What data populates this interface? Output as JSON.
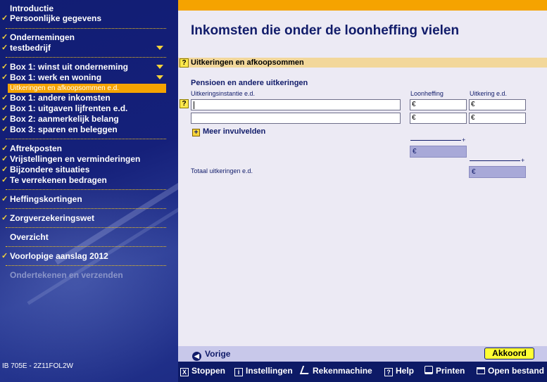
{
  "sidebar": {
    "items": [
      {
        "label": "Introductie",
        "checked": false
      },
      {
        "label": "Persoonlijke gegevens",
        "checked": true
      },
      {
        "label": "Ondernemingen",
        "checked": true
      },
      {
        "label": "testbedrijf",
        "checked": true
      },
      {
        "label": "Box 1: winst uit onderneming",
        "checked": true
      },
      {
        "label": "Box 1: werk en woning",
        "checked": true
      },
      {
        "label": "Uitkeringen en afkoopsommen e.d.",
        "active": true
      },
      {
        "label": "Box 1: andere inkomsten",
        "checked": true
      },
      {
        "label": "Box 1: uitgaven lijfrenten e.d.",
        "checked": true
      },
      {
        "label": "Box 2: aanmerkelijk belang",
        "checked": true
      },
      {
        "label": "Box 3: sparen en beleggen",
        "checked": true
      },
      {
        "label": "Aftrekposten",
        "checked": true
      },
      {
        "label": "Vrijstellingen en verminderingen",
        "checked": true
      },
      {
        "label": "Bijzondere situaties",
        "checked": true
      },
      {
        "label": "Te verrekenen bedragen",
        "checked": true
      },
      {
        "label": "Heffingskortingen",
        "checked": true
      },
      {
        "label": "Zorgverzekeringswet",
        "checked": true
      },
      {
        "label": "Overzicht",
        "checked": false
      },
      {
        "label": "Voorlopige aanslag 2012",
        "checked": true
      },
      {
        "label": "Ondertekenen en verzenden",
        "disabled": true
      }
    ],
    "footer_code": "IB 705E - 2Z11FOL2W",
    "check_glyph": "✓"
  },
  "main": {
    "title": "Inkomsten die onder de loonheffing vielen",
    "help_glyph": "?",
    "section_title": "Uitkeringen en afkoopsommen",
    "group_title": "Pensioen en andere uitkeringen",
    "columns": {
      "instantie": "Uitkeringsinstantie e.d.",
      "loonheffing": "Loonheffing",
      "uitkering": "Uitkering e.d."
    },
    "currency": "€",
    "rows": [
      {
        "instantie": "",
        "loonheffing": "€",
        "uitkering": "€"
      },
      {
        "instantie": "",
        "loonheffing": "€",
        "uitkering": "€"
      }
    ],
    "more_fields": "Meer invulvelden",
    "plus_sign": "+",
    "sum_loonheffing": "€",
    "total_label": "Totaal uitkeringen e.d.",
    "total_uitkering": "€"
  },
  "nav": {
    "back_label": "Vorige",
    "ok_label": "Akkoord"
  },
  "toolbar": {
    "items": [
      {
        "label": "Stoppen",
        "icon": "close-icon",
        "glyph": "X"
      },
      {
        "label": "Instellingen",
        "icon": "info-icon",
        "glyph": "i"
      },
      {
        "label": "Rekenmachine",
        "icon": "calculator-icon",
        "glyph": ""
      },
      {
        "label": "Help",
        "icon": "help-icon",
        "glyph": "?"
      },
      {
        "label": "Printen",
        "icon": "printer-icon",
        "glyph": ""
      },
      {
        "label": "Open bestand",
        "icon": "folder-icon",
        "glyph": ""
      }
    ]
  },
  "colors": {
    "sidebar_bg": "#111d73",
    "accent": "#f5a300",
    "title": "#111c6a",
    "ok_button": "#ffff33"
  }
}
